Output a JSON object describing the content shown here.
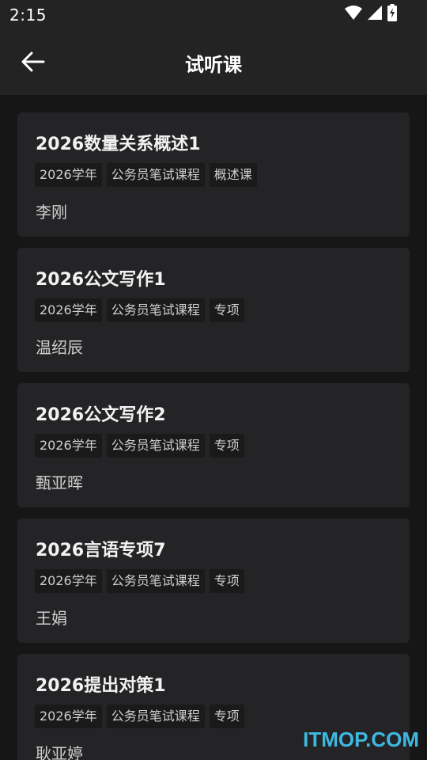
{
  "status_bar": {
    "time": "2:15",
    "icons": [
      "wifi-icon",
      "cell-signal-icon",
      "battery-charging-icon"
    ]
  },
  "app_bar": {
    "back_icon": "arrow-left-icon",
    "title": "试听课"
  },
  "courses": [
    {
      "title": "2026数量关系概述1",
      "tags": [
        "2026学年",
        "公务员笔试课程",
        "概述课"
      ],
      "teacher": "李刚"
    },
    {
      "title": "2026公文写作1",
      "tags": [
        "2026学年",
        "公务员笔试课程",
        "专项"
      ],
      "teacher": "温绍辰"
    },
    {
      "title": "2026公文写作2",
      "tags": [
        "2026学年",
        "公务员笔试课程",
        "专项"
      ],
      "teacher": "甄亚晖"
    },
    {
      "title": "2026言语专项7",
      "tags": [
        "2026学年",
        "公务员笔试课程",
        "专项"
      ],
      "teacher": "王娟"
    },
    {
      "title": "2026提出对策1",
      "tags": [
        "2026学年",
        "公务员笔试课程",
        "专项"
      ],
      "teacher": "耿亚婷"
    }
  ],
  "watermark": "ITMOP.COM",
  "colors": {
    "background": "#161616",
    "bar": "#232323",
    "card": "#242426",
    "tag": "#1a1a1a",
    "watermark": "#3fb8e0"
  }
}
